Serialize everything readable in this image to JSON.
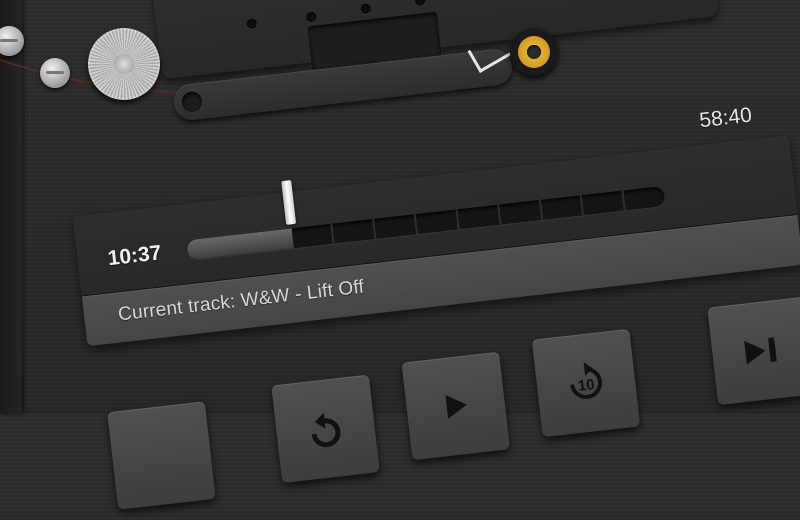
{
  "player": {
    "time_elapsed": "10:37",
    "time_total": "58:40",
    "current_track_label": "Current track: W&W - Lift Off",
    "progress_fraction": 0.22,
    "progress_segments": 9
  },
  "controls": {
    "buttons": [
      {
        "name": "rewind-button",
        "icon": "rewind-icon"
      },
      {
        "name": "replay-button",
        "icon": "replay-icon"
      },
      {
        "name": "play-button",
        "icon": "play-icon"
      },
      {
        "name": "skip-forward-10-button",
        "icon": "forward-10-icon",
        "label": "10"
      },
      {
        "name": "next-track-button",
        "icon": "next-track-icon"
      }
    ]
  },
  "colors": {
    "accent": "#e0a420",
    "background": "#2a2a2a",
    "text": "#e8e8e8"
  }
}
